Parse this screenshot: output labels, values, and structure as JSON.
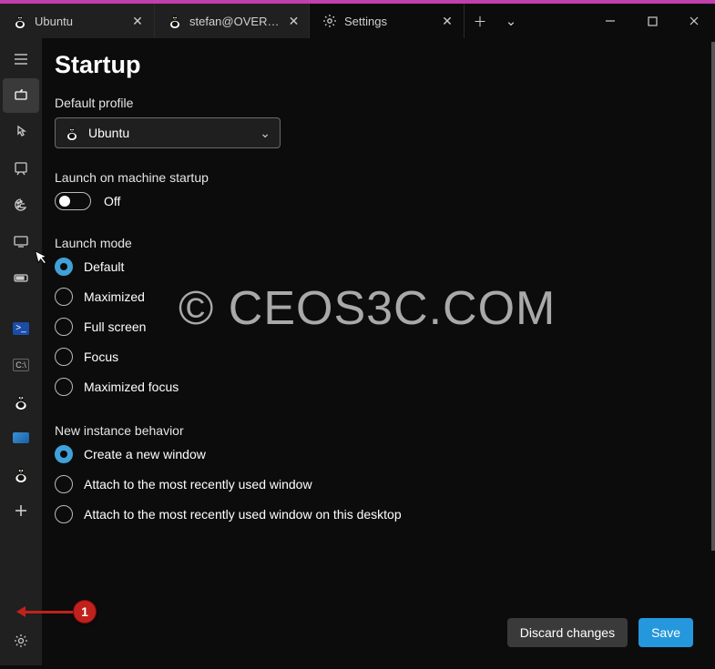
{
  "tabs": [
    {
      "label": "Ubuntu"
    },
    {
      "label": "stefan@OVERLORD"
    },
    {
      "label": "Settings"
    }
  ],
  "page": {
    "title": "Startup"
  },
  "default_profile": {
    "label": "Default profile",
    "value": "Ubuntu"
  },
  "launch_on_startup": {
    "label": "Launch on machine startup",
    "state_text": "Off"
  },
  "launch_mode": {
    "label": "Launch mode",
    "options": [
      "Default",
      "Maximized",
      "Full screen",
      "Focus",
      "Maximized focus"
    ],
    "selected_index": 0
  },
  "new_instance": {
    "label": "New instance behavior",
    "options": [
      "Create a new window",
      "Attach to the most recently used window",
      "Attach to the most recently used window on this desktop"
    ],
    "selected_index": 0
  },
  "footer": {
    "discard": "Discard changes",
    "save": "Save"
  },
  "watermark": "© CEOS3C.COM",
  "annotation_number": "1"
}
